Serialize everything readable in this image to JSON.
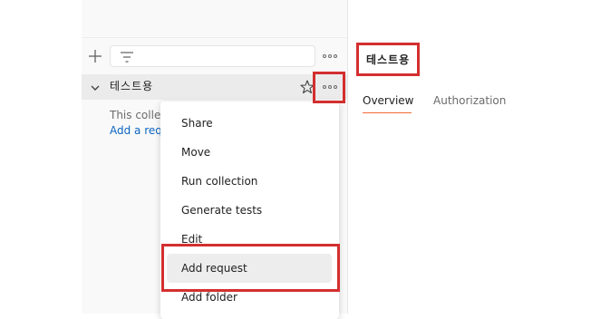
{
  "sidebar": {
    "collection": {
      "name": "테스트용"
    },
    "empty_state": {
      "text": "This collection",
      "link": "Add a request"
    }
  },
  "context_menu": {
    "items": [
      {
        "label": "Share"
      },
      {
        "label": "Move"
      },
      {
        "label": "Run collection"
      },
      {
        "label": "Generate tests"
      },
      {
        "label": "Edit"
      },
      {
        "label": "Add request"
      },
      {
        "label": "Add folder"
      }
    ],
    "highlighted": "Add request"
  },
  "workspace": {
    "title": "테스트용",
    "tabs": [
      {
        "label": "Overview",
        "active": true
      },
      {
        "label": "Authorization",
        "active": false
      }
    ]
  },
  "colors": {
    "highlight_box": "#d32f2f",
    "active_tab_underline": "#f26b3a",
    "link": "#0b65c2"
  },
  "icons": [
    "plus-icon",
    "filter-icon",
    "more-horizontal-icon",
    "chevron-down-icon",
    "star-icon"
  ]
}
